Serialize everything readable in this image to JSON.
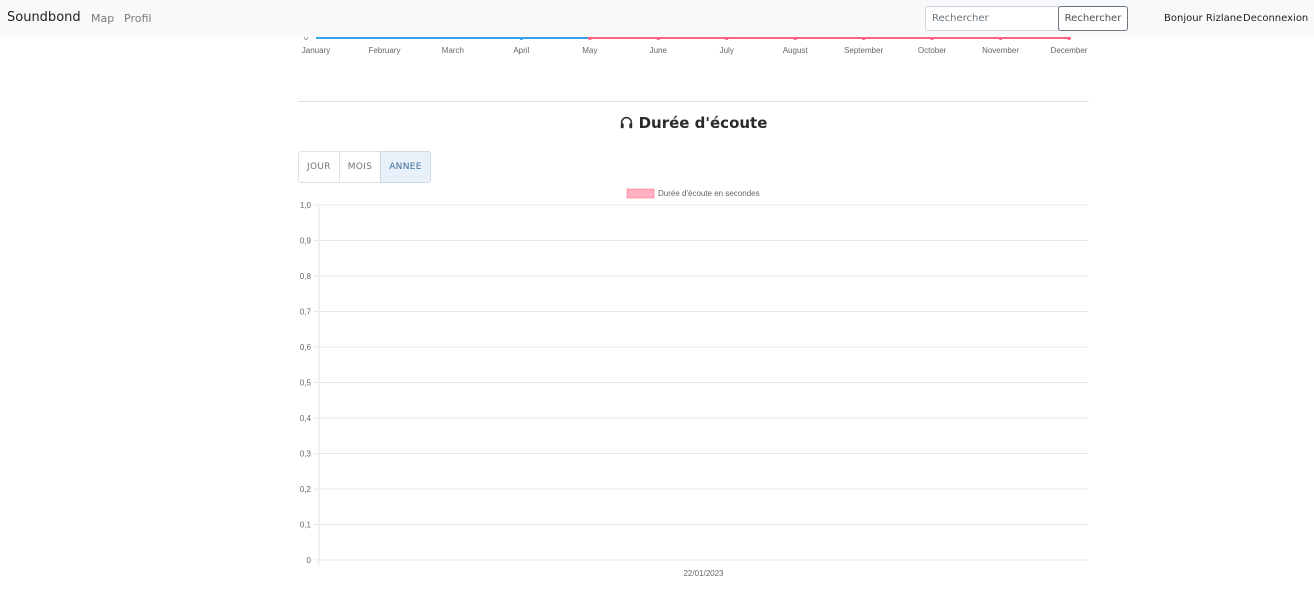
{
  "nav": {
    "brand": "Soundbond",
    "links": [
      "Map",
      "Profil"
    ],
    "search_placeholder": "Rechercher",
    "search_button": "Rechercher",
    "greeting": "Bonjour Rizlane",
    "logout": "Deconnexion"
  },
  "section": {
    "title": "Durée d'écoute",
    "icon": "headphones-icon",
    "period_buttons": [
      "JOUR",
      "MOIS",
      "ANNEE"
    ],
    "active_period": "ANNEE"
  },
  "chart_data": [
    {
      "type": "line",
      "partially_visible": true,
      "categories": [
        "January",
        "February",
        "March",
        "April",
        "May",
        "June",
        "July",
        "August",
        "September",
        "October",
        "November",
        "December"
      ],
      "visible_tick_label": "0",
      "series": [
        {
          "color": "#36a2eb",
          "values": [
            0,
            0,
            0,
            0,
            0,
            0,
            0,
            0,
            0,
            0,
            0,
            0
          ]
        },
        {
          "color": "#ff6384",
          "values": [
            null,
            null,
            null,
            null,
            0,
            0,
            0,
            0,
            0,
            0,
            0,
            0
          ]
        }
      ]
    },
    {
      "type": "bar",
      "legend": "Durée d'écoute en secondes",
      "legend_position": "top",
      "legend_color": "#ffb1c1",
      "categories": [
        "22/01/2023"
      ],
      "values": [
        0
      ],
      "ylim": [
        0,
        1
      ],
      "yticks": [
        "1,0",
        "0,9",
        "0,8",
        "0,7",
        "0,6",
        "0,5",
        "0,4",
        "0,3",
        "0,2",
        "0,1",
        "0"
      ],
      "grid": true
    }
  ]
}
